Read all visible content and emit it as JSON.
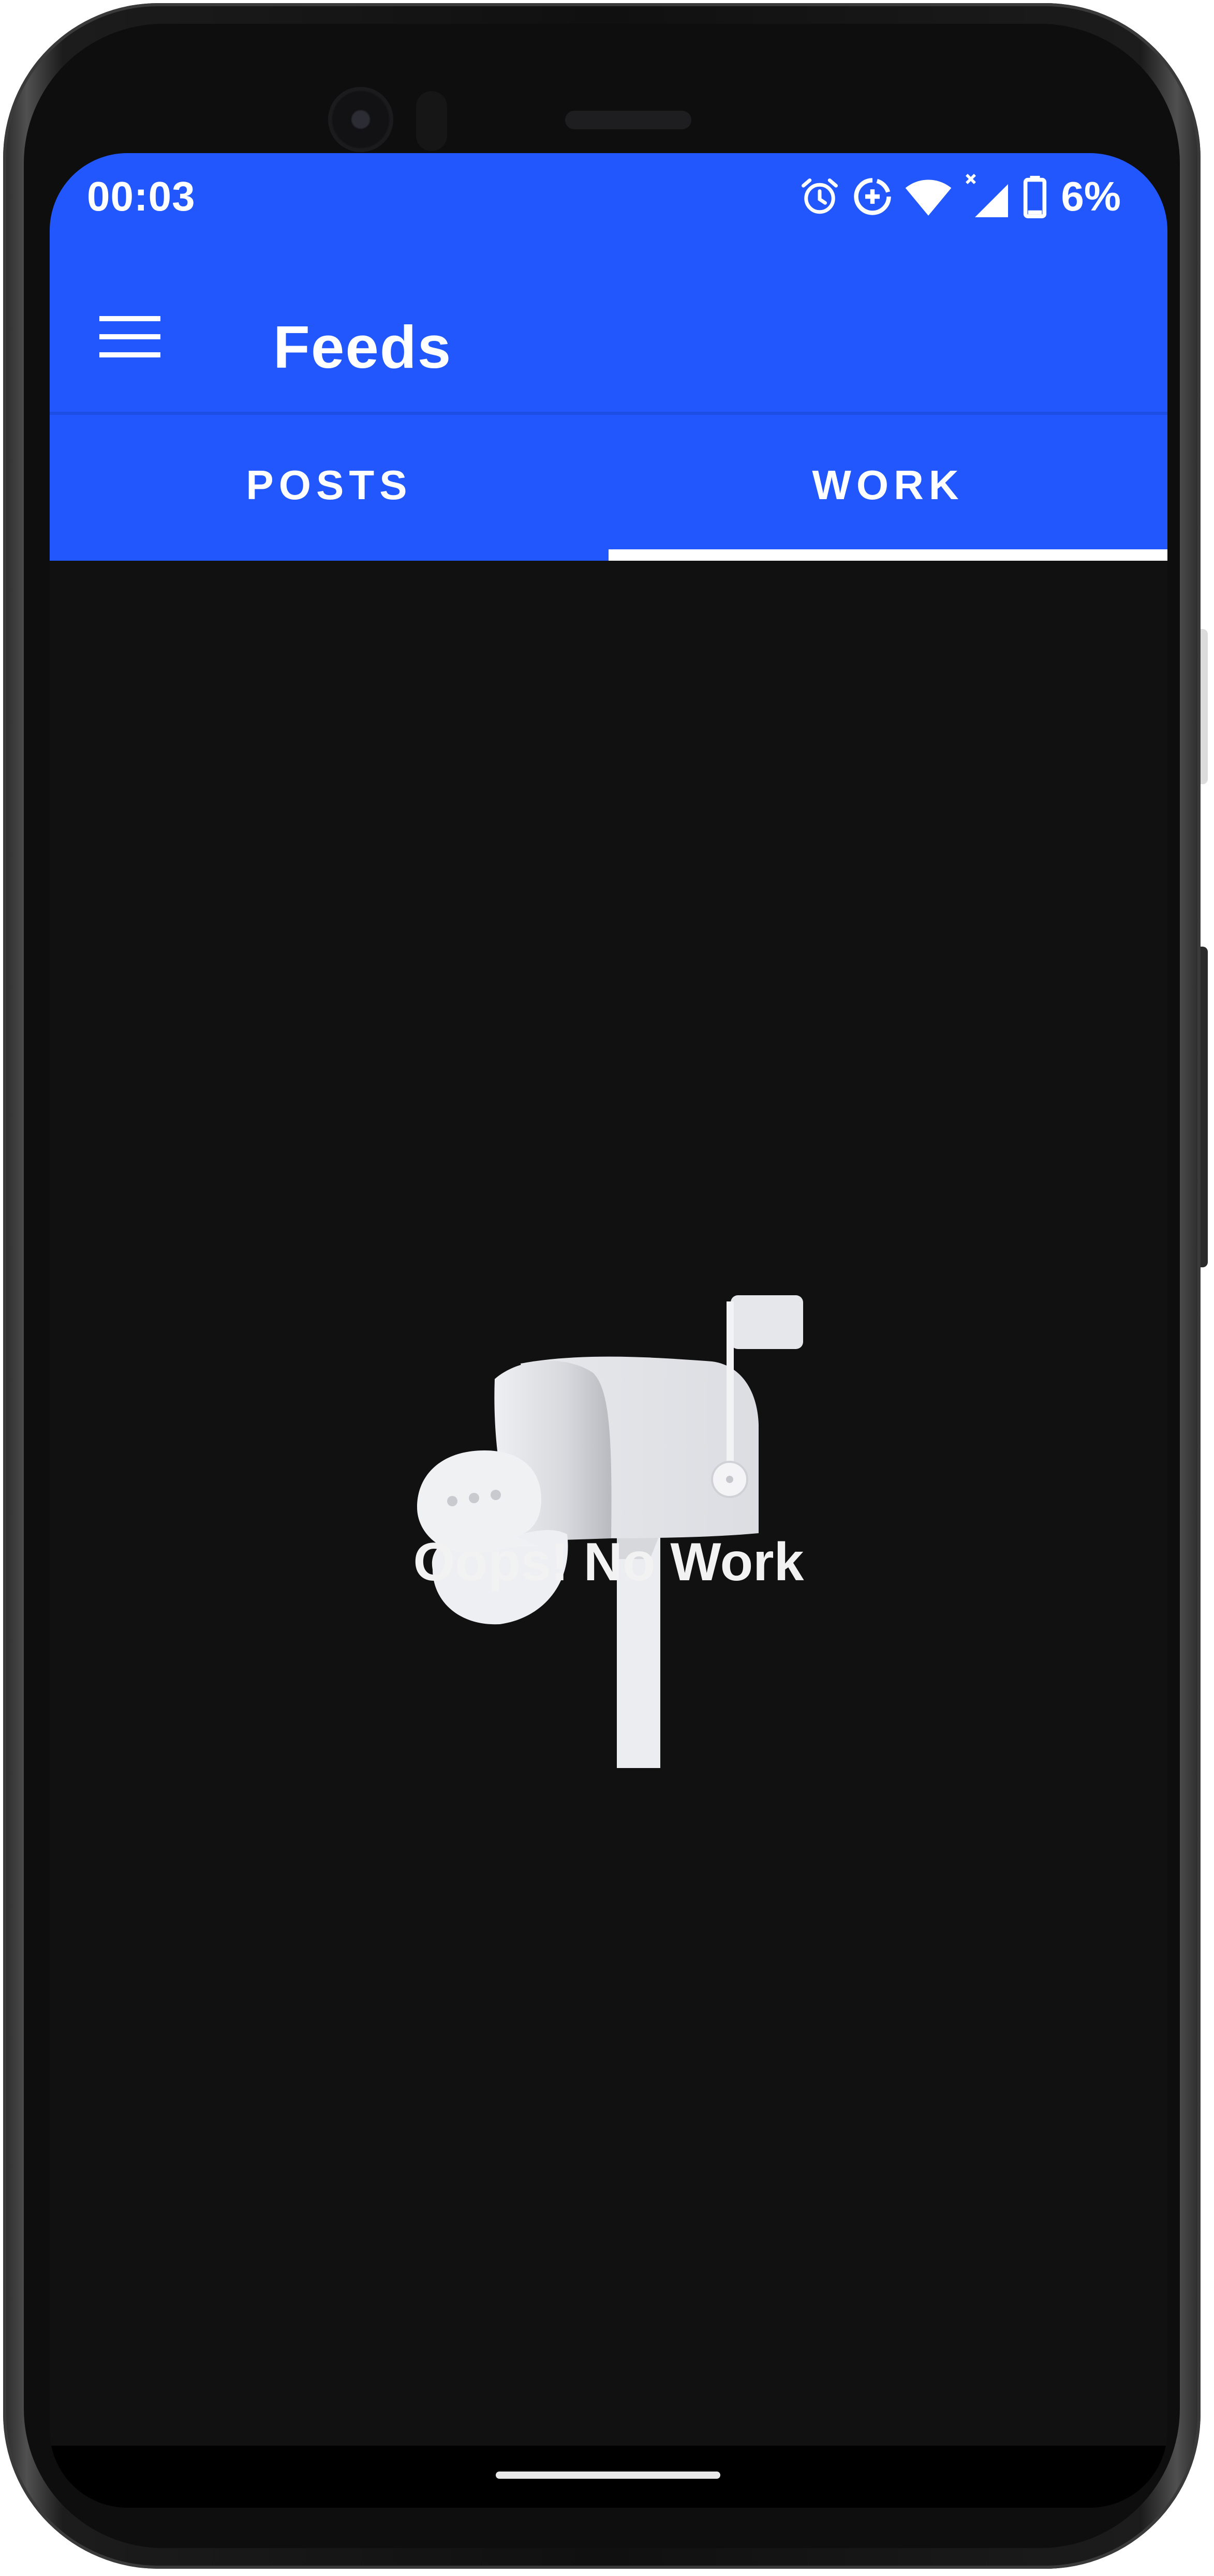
{
  "status_bar": {
    "time": "00:03",
    "battery_percent": "6%",
    "icons": [
      "alarm-icon",
      "data-saver-icon",
      "wifi-icon",
      "signal-no-data-icon",
      "battery-icon"
    ]
  },
  "app_bar": {
    "title": "Feeds",
    "menu_icon": "hamburger-menu-icon"
  },
  "tabs": [
    {
      "label": "POSTS",
      "selected": false
    },
    {
      "label": "WORK",
      "selected": true
    }
  ],
  "empty_state": {
    "illustration": "mailbox-icon",
    "message": "Oops! No Work"
  },
  "colors": {
    "primary": "#2157fd",
    "background": "#111111",
    "tab_indicator": "#ffffff",
    "text": "#ffffff"
  }
}
